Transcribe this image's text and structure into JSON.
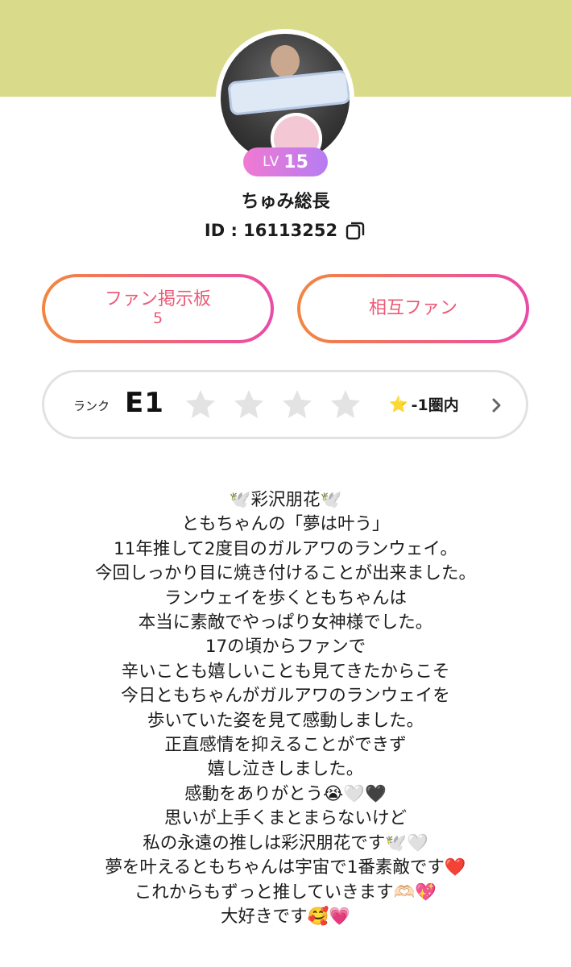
{
  "header": {
    "band_color": "#d9db8a"
  },
  "profile": {
    "level_prefix": "LV",
    "level": "15",
    "username": "ちゅみ総長",
    "id_text": "ID : 16113252",
    "copy_icon": "copy-icon"
  },
  "buttons": {
    "fan_board_label": "ファン掲示板",
    "fan_board_count": "5",
    "mutual_fan_label": "相互ファン",
    "accent_gradient": [
      "#f2873f",
      "#ea4aa9"
    ]
  },
  "rank": {
    "label": "ランク",
    "value": "E1",
    "stars_filled": 0,
    "stars_total": 4,
    "status_icon": "⭐",
    "status_text": "-1圏内"
  },
  "bio": {
    "lines": [
      "🕊️彩沢朋花🕊️",
      "ともちゃんの「夢は叶う」",
      "11年推して2度目のガルアワのランウェイ。",
      "今回しっかり目に焼き付けることが出来ました。",
      "ランウェイを歩くともちゃんは",
      "本当に素敵でやっぱり女神様でした。",
      "17の頃からファンで",
      "辛いことも嬉しいことも見てきたからこそ",
      "今日ともちゃんがガルアワのランウェイを",
      "歩いていた姿を見て感動しました。",
      "正直感情を抑えることができず",
      "嬉し泣きしました。",
      "感動をありがとう😭🤍🖤",
      "思いが上手くまとまらないけど",
      "私の永遠の推しは彩沢朋花です🕊️🤍",
      "夢を叶えるともちゃんは宇宙で1番素敵です❤️",
      "これからもずっと推していきます🫶🏻💖",
      "大好きです🥰💗"
    ]
  }
}
